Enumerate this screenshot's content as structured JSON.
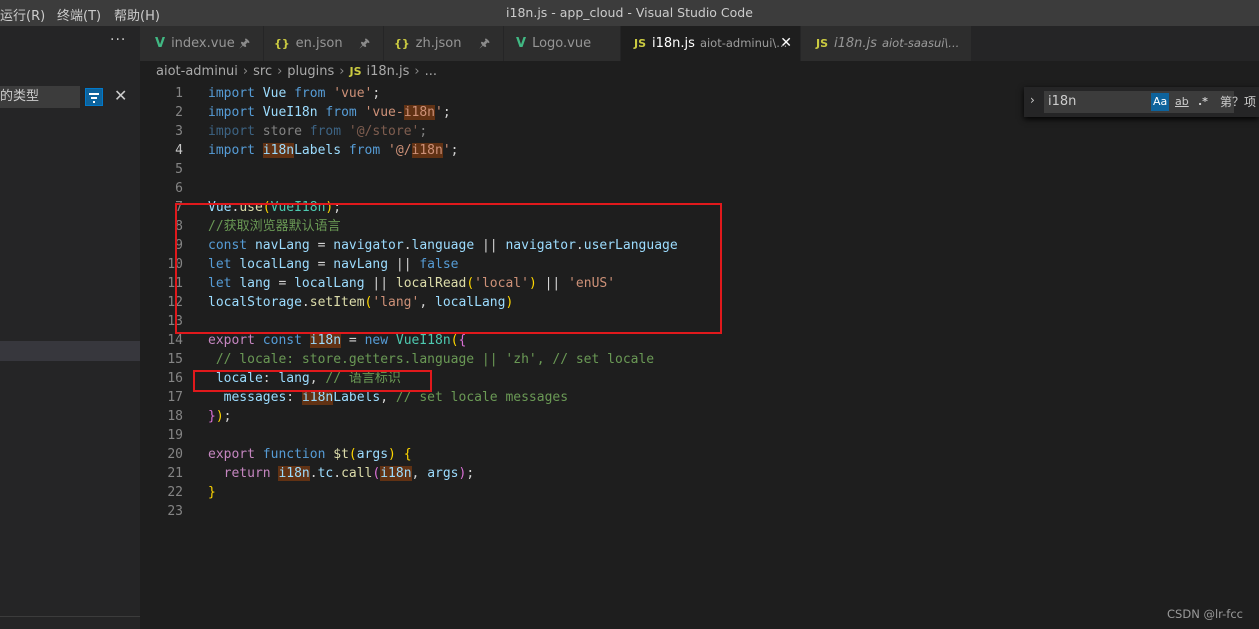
{
  "menu": [
    "运行(R)",
    "终端(T)",
    "帮助(H)"
  ],
  "window_title": "i18n.js - app_cloud - Visual Studio Code",
  "sidebar": {
    "more_glyph": "···",
    "search_value": "的类型",
    "close_glyph": "✕"
  },
  "tabs": [
    {
      "icon_glyph": "V",
      "label": "index.vue",
      "pin": "🖈"
    },
    {
      "icon_glyph": "{}",
      "label": "en.json",
      "pin": "🖈"
    },
    {
      "icon_glyph": "{}",
      "label": "zh.json",
      "pin": "🖈"
    },
    {
      "icon_glyph": "V",
      "label": "Logo.vue"
    },
    {
      "icon_glyph": "JS",
      "label": "i18n.js",
      "desc": "aiot-adminui\\...",
      "close": "✕"
    },
    {
      "icon_glyph": "JS",
      "label": "i18n.js",
      "desc": "aiot-saasui\\..."
    }
  ],
  "breadcrumb": {
    "parts": [
      "aiot-adminui",
      "src",
      "plugins"
    ],
    "file_icon": "JS",
    "file": "i18n.js",
    "tail": "...",
    "sep": "›"
  },
  "find_widget": {
    "chevron": "›",
    "query": "i18n",
    "match_case": "Aa",
    "whole_word": "ab",
    "regex": ".*",
    "count": "第？项"
  },
  "code": {
    "current_line": 4,
    "lines": [
      {
        "n": "1",
        "t": [
          [
            "kw",
            "import"
          ],
          [
            "pl",
            " "
          ],
          [
            "id",
            "Vue"
          ],
          [
            "pl",
            " "
          ],
          [
            "kw",
            "from"
          ],
          [
            "pl",
            " "
          ],
          [
            "str",
            "'vue'"
          ],
          [
            "pl",
            ";"
          ]
        ]
      },
      {
        "n": "2",
        "t": [
          [
            "kw",
            "import"
          ],
          [
            "pl",
            " "
          ],
          [
            "id",
            "VueI18n"
          ],
          [
            "pl",
            " "
          ],
          [
            "kw",
            "from"
          ],
          [
            "pl",
            " "
          ],
          [
            "str",
            "'vue-"
          ],
          [
            "str hl",
            "i18n"
          ],
          [
            "str",
            "'"
          ],
          [
            "pl",
            ";"
          ]
        ]
      },
      {
        "n": "3",
        "t": [
          [
            "kw dim",
            "import"
          ],
          [
            "pl dim",
            " store "
          ],
          [
            "kw dim",
            "from"
          ],
          [
            "pl dim",
            " "
          ],
          [
            "str dim",
            "'@/store'"
          ],
          [
            "pl dim",
            ";"
          ]
        ]
      },
      {
        "n": "4",
        "t": [
          [
            "kw",
            "import"
          ],
          [
            "pl",
            " "
          ],
          [
            "id hl",
            "i18n"
          ],
          [
            "id",
            "Labels"
          ],
          [
            "pl",
            " "
          ],
          [
            "kw",
            "from"
          ],
          [
            "pl",
            " "
          ],
          [
            "str",
            "'@/"
          ],
          [
            "str hl",
            "i18n"
          ],
          [
            "str",
            "'"
          ],
          [
            "pl",
            ";"
          ]
        ]
      },
      {
        "n": "5",
        "t": []
      },
      {
        "n": "6",
        "t": []
      },
      {
        "n": "7",
        "t": [
          [
            "id",
            "Vue"
          ],
          [
            "pl",
            "."
          ],
          [
            "fn",
            "use"
          ],
          [
            "br",
            "("
          ],
          [
            "cls",
            "VueI18n"
          ],
          [
            "br",
            ")"
          ],
          [
            "pl",
            ";"
          ]
        ]
      },
      {
        "n": "8",
        "t": [
          [
            "cm",
            "//获取浏览器默认语言"
          ]
        ]
      },
      {
        "n": "9",
        "t": [
          [
            "kw",
            "const"
          ],
          [
            "pl",
            " "
          ],
          [
            "id",
            "navLang"
          ],
          [
            "pl",
            " = "
          ],
          [
            "id",
            "navigator"
          ],
          [
            "pl",
            "."
          ],
          [
            "id",
            "language"
          ],
          [
            "pl",
            " || "
          ],
          [
            "id",
            "navigator"
          ],
          [
            "pl",
            "."
          ],
          [
            "id",
            "userLanguage"
          ]
        ]
      },
      {
        "n": "10",
        "t": [
          [
            "kw",
            "let"
          ],
          [
            "pl",
            " "
          ],
          [
            "id",
            "localLang"
          ],
          [
            "pl",
            " = "
          ],
          [
            "id",
            "navLang"
          ],
          [
            "pl",
            " || "
          ],
          [
            "kw",
            "false"
          ]
        ]
      },
      {
        "n": "11",
        "t": [
          [
            "kw",
            "let"
          ],
          [
            "pl",
            " "
          ],
          [
            "id",
            "lang"
          ],
          [
            "pl",
            " = "
          ],
          [
            "id",
            "localLang"
          ],
          [
            "pl",
            " || "
          ],
          [
            "fn",
            "localRead"
          ],
          [
            "br",
            "("
          ],
          [
            "str",
            "'local'"
          ],
          [
            "br",
            ")"
          ],
          [
            "pl",
            " || "
          ],
          [
            "str",
            "'enUS'"
          ]
        ]
      },
      {
        "n": "12",
        "t": [
          [
            "id",
            "localStorage"
          ],
          [
            "pl",
            "."
          ],
          [
            "fn",
            "setItem"
          ],
          [
            "br",
            "("
          ],
          [
            "str",
            "'lang'"
          ],
          [
            "pl",
            ", "
          ],
          [
            "id",
            "localLang"
          ],
          [
            "br",
            ")"
          ]
        ]
      },
      {
        "n": "13",
        "t": []
      },
      {
        "n": "14",
        "t": [
          [
            "cf",
            "export"
          ],
          [
            "pl",
            " "
          ],
          [
            "kw",
            "const"
          ],
          [
            "pl",
            " "
          ],
          [
            "id hl",
            "i18n"
          ],
          [
            "pl",
            " = "
          ],
          [
            "kw",
            "new"
          ],
          [
            "pl",
            " "
          ],
          [
            "cls",
            "VueI18n"
          ],
          [
            "br",
            "("
          ],
          [
            "br2",
            "{"
          ]
        ]
      },
      {
        "n": "15",
        "t": [
          [
            "pl",
            " "
          ],
          [
            "cm",
            "// locale: store.getters.language || 'zh', // set locale"
          ]
        ]
      },
      {
        "n": "16",
        "t": [
          [
            "pl",
            " "
          ],
          [
            "id",
            "locale"
          ],
          [
            "pl",
            ": "
          ],
          [
            "id",
            "lang"
          ],
          [
            "pl",
            ", "
          ],
          [
            "cm",
            "// 语言标识"
          ]
        ]
      },
      {
        "n": "17",
        "t": [
          [
            "pl",
            "  "
          ],
          [
            "id",
            "messages"
          ],
          [
            "pl",
            ": "
          ],
          [
            "id hl",
            "i18n"
          ],
          [
            "id",
            "Labels"
          ],
          [
            "pl",
            ", "
          ],
          [
            "cm",
            "// set locale messages"
          ]
        ]
      },
      {
        "n": "18",
        "t": [
          [
            "br2",
            "}"
          ],
          [
            "br",
            ")"
          ],
          [
            "pl",
            ";"
          ]
        ]
      },
      {
        "n": "19",
        "t": []
      },
      {
        "n": "20",
        "t": [
          [
            "cf",
            "export"
          ],
          [
            "pl",
            " "
          ],
          [
            "kw",
            "function"
          ],
          [
            "pl",
            " "
          ],
          [
            "fn",
            "$t"
          ],
          [
            "br",
            "("
          ],
          [
            "id",
            "args"
          ],
          [
            "br",
            ")"
          ],
          [
            "pl",
            " "
          ],
          [
            "br",
            "{"
          ]
        ]
      },
      {
        "n": "21",
        "t": [
          [
            "pl",
            "  "
          ],
          [
            "cf",
            "return"
          ],
          [
            "pl",
            " "
          ],
          [
            "id hl",
            "i18n"
          ],
          [
            "pl",
            "."
          ],
          [
            "id",
            "tc"
          ],
          [
            "pl",
            "."
          ],
          [
            "fn",
            "call"
          ],
          [
            "br2",
            "("
          ],
          [
            "id hl",
            "i18n"
          ],
          [
            "pl",
            ", "
          ],
          [
            "id",
            "args"
          ],
          [
            "br2",
            ")"
          ],
          [
            "pl",
            ";"
          ]
        ]
      },
      {
        "n": "22",
        "t": [
          [
            "br",
            "}"
          ]
        ]
      },
      {
        "n": "23",
        "t": []
      }
    ]
  },
  "watermark": "CSDN @lr-fcc"
}
